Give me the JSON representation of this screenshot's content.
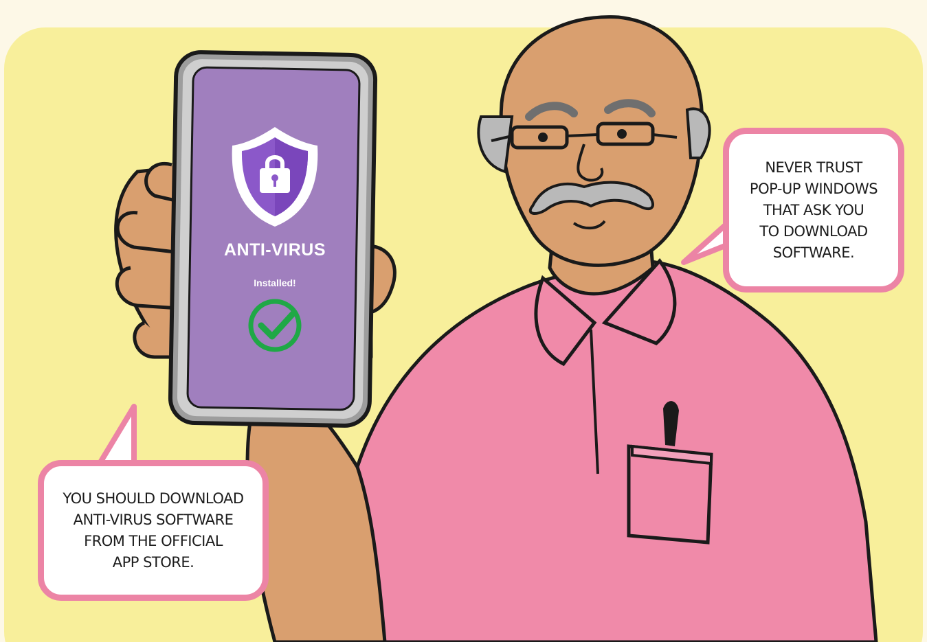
{
  "phone": {
    "app_name": "ANTI-VIRUS",
    "status": "Installed!",
    "status_icon": "check-circle-icon",
    "shield_icon": "shield-lock-icon"
  },
  "bubbles": {
    "right": {
      "lines": [
        "NEVER TRUST",
        "POP-UP WINDOWS",
        "THAT ASK YOU",
        "TO DOWNLOAD",
        "SOFTWARE."
      ]
    },
    "left": {
      "lines": [
        "YOU SHOULD DOWNLOAD",
        "ANTI-VIRUS SOFTWARE",
        "FROM THE OFFICIAL",
        "APP STORE."
      ]
    }
  },
  "colors": {
    "background": "#f8ef9b",
    "phone_screen": "#a07fbe",
    "shield": "#8b58c9",
    "check": "#1fa846",
    "bubble_border": "#ec84a5",
    "shirt": "#f08aa9",
    "skin": "#d99f6f"
  }
}
